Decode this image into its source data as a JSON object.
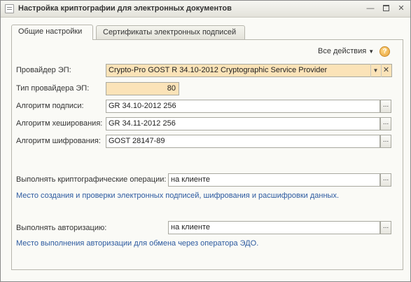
{
  "window": {
    "title": "Настройка криптографии для электронных документов",
    "minimize_glyph": "—",
    "close_glyph": "✕"
  },
  "tabs": [
    {
      "label": "Общие настройки",
      "active": true
    },
    {
      "label": "Сертификаты электронных подписей",
      "active": false
    }
  ],
  "toolbar": {
    "all_actions": "Все действия",
    "help_glyph": "?"
  },
  "form": {
    "provider_label": "Провайдер ЭП:",
    "provider_value": "Crypto-Pro GOST R 34.10-2012 Cryptographic Service Provider",
    "provider_type_label": "Тип провайдера ЭП:",
    "provider_type_value": "80",
    "sign_algo_label": "Алгоритм подписи:",
    "sign_algo_value": "GR 34.10-2012 256",
    "hash_algo_label": "Алгоритм хеширования:",
    "hash_algo_value": "GR 34.11-2012 256",
    "encrypt_algo_label": "Алгоритм шифрования:",
    "encrypt_algo_value": "GOST 28147-89",
    "crypto_ops_label": "Выполнять криптографические операции:",
    "crypto_ops_value": "на клиенте",
    "crypto_ops_note": "Место создания и проверки электронных подписей, шифрования и расшифровки данных.",
    "auth_label": "Выполнять авторизацию:",
    "auth_value": "на клиенте",
    "auth_note": "Место выполнения авторизации для обмена через оператора ЭДО."
  },
  "colors": {
    "highlight_field": "#fbe3b8",
    "note_text": "#2c5aa0"
  }
}
